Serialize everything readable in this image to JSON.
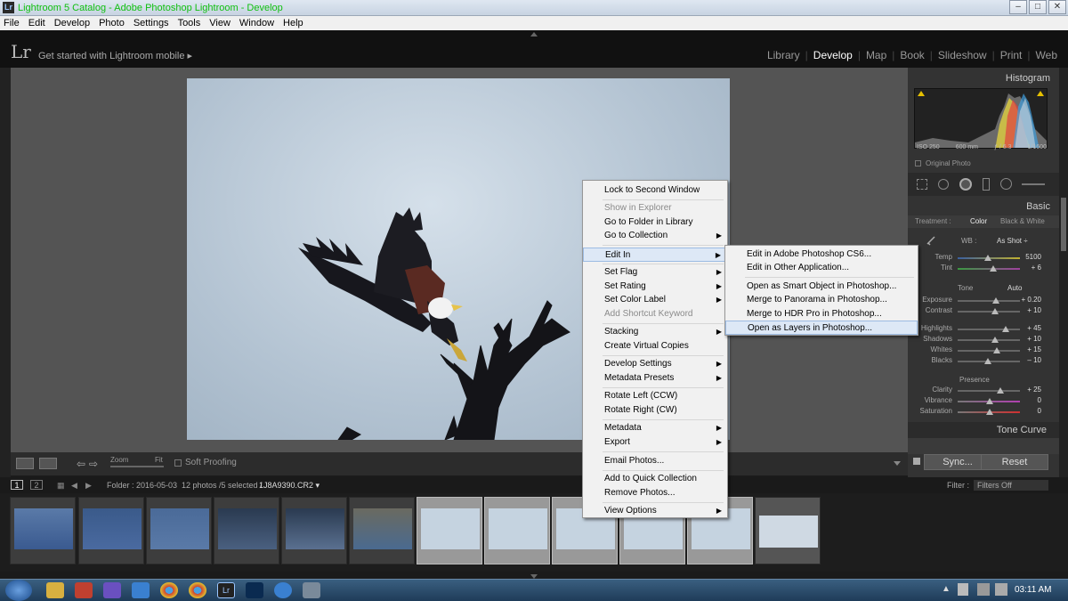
{
  "window": {
    "title": "Lightroom 5 Catalog - Adobe Photoshop Lightroom - Develop",
    "logo_text": "Lr",
    "controls": [
      "–",
      "□",
      "✕"
    ]
  },
  "menubar": [
    "File",
    "Edit",
    "Develop",
    "Photo",
    "Settings",
    "Tools",
    "View",
    "Window",
    "Help"
  ],
  "topbar": {
    "logo": "Lr",
    "mobile_prompt": "Get started with Lightroom mobile ▸",
    "modules": [
      "Library",
      "Develop",
      "Map",
      "Book",
      "Slideshow",
      "Print",
      "Web"
    ],
    "active_module": "Develop"
  },
  "toolbar": {
    "zoom_label": "Zoom",
    "fit_label": "Fit",
    "soft_proofing": "Soft Proofing"
  },
  "right_panel": {
    "histogram_title": "Histogram",
    "exif": [
      "ISO 250",
      "600 mm",
      "ƒ / 6.3",
      "1/1600"
    ],
    "original_photo": "Original Photo",
    "basic_title": "Basic",
    "treatment_label": "Treatment :",
    "treatment_color": "Color",
    "treatment_bw": "Black & White",
    "wb_label": "WB :",
    "wb_value": "As Shot ÷",
    "tone_label": "Tone",
    "auto_label": "Auto",
    "presence_label": "Presence",
    "tone_curve_title": "Tone Curve",
    "sync_button": "Sync...",
    "reset_button": "Reset",
    "sliders": [
      {
        "name": "Temp",
        "value": "5100"
      },
      {
        "name": "Tint",
        "value": "+ 6"
      },
      {
        "name": "Exposure",
        "value": "+ 0.20"
      },
      {
        "name": "Contrast",
        "value": "+ 10"
      },
      {
        "name": "Highlights",
        "value": "+ 45"
      },
      {
        "name": "Shadows",
        "value": "+ 10"
      },
      {
        "name": "Whites",
        "value": "+ 15"
      },
      {
        "name": "Blacks",
        "value": "– 10"
      },
      {
        "name": "Clarity",
        "value": "+ 25"
      },
      {
        "name": "Vibrance",
        "value": "0"
      },
      {
        "name": "Saturation",
        "value": "0"
      }
    ]
  },
  "filmbar": {
    "page_1": "1",
    "page_2": "2",
    "folder": "Folder : 2016-05-03",
    "count": "12 photos /5 selected /",
    "filename": "1J8A9390.CR2 ▾",
    "filter_label": "Filter :",
    "filter_value": "Filters Off"
  },
  "context_menu": {
    "items": [
      {
        "label": "Lock to Second Window",
        "disabled": false,
        "submenu": false
      },
      {
        "label": "Show in Explorer",
        "disabled": true,
        "submenu": false
      },
      {
        "label": "Go to Folder in Library",
        "disabled": false,
        "submenu": false
      },
      {
        "label": "Go to Collection",
        "disabled": false,
        "submenu": true
      },
      {
        "label": "Edit In",
        "disabled": false,
        "submenu": true
      },
      {
        "label": "Set Flag",
        "disabled": false,
        "submenu": true
      },
      {
        "label": "Set Rating",
        "disabled": false,
        "submenu": true
      },
      {
        "label": "Set Color Label",
        "disabled": false,
        "submenu": true
      },
      {
        "label": "Add Shortcut Keyword",
        "disabled": true,
        "submenu": false
      },
      {
        "label": "Stacking",
        "disabled": false,
        "submenu": true
      },
      {
        "label": "Create Virtual Copies",
        "disabled": false,
        "submenu": false
      },
      {
        "label": "Develop Settings",
        "disabled": false,
        "submenu": true
      },
      {
        "label": "Metadata Presets",
        "disabled": false,
        "submenu": true
      },
      {
        "label": "Rotate Left (CCW)",
        "disabled": false,
        "submenu": false
      },
      {
        "label": "Rotate Right (CW)",
        "disabled": false,
        "submenu": false
      },
      {
        "label": "Metadata",
        "disabled": false,
        "submenu": true
      },
      {
        "label": "Export",
        "disabled": false,
        "submenu": true
      },
      {
        "label": "Email Photos...",
        "disabled": false,
        "submenu": false
      },
      {
        "label": "Add to Quick Collection",
        "disabled": false,
        "submenu": false
      },
      {
        "label": "Remove Photos...",
        "disabled": false,
        "submenu": false
      },
      {
        "label": "View Options",
        "disabled": false,
        "submenu": true
      }
    ],
    "highlighted": "Edit In"
  },
  "submenu": {
    "items": [
      "Edit in Adobe Photoshop CS6...",
      "Edit in Other Application...",
      "Open as Smart Object in Photoshop...",
      "Merge to Panorama in Photoshop...",
      "Merge to HDR Pro in Photoshop...",
      "Open as Layers in Photoshop..."
    ],
    "highlighted": "Open as Layers in Photoshop..."
  },
  "taskbar": {
    "time": "03:11 AM"
  },
  "colors": {
    "accent_highlight": "#dde8f6",
    "title_text": "#10c010",
    "panel_bg": "#333333"
  }
}
